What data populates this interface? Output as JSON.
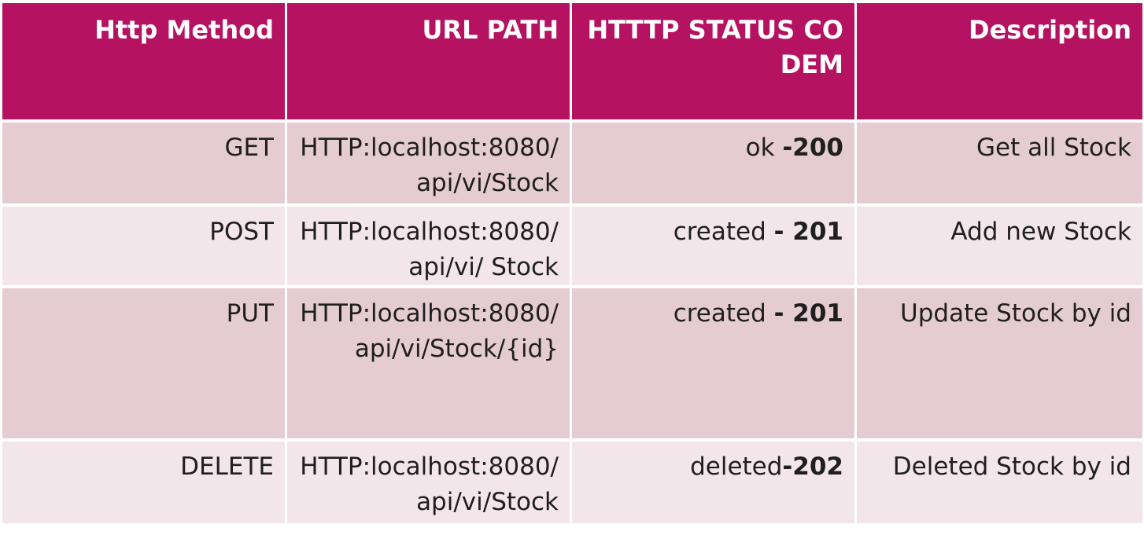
{
  "headers": [
    "Http Method",
    "URL PATH",
    "HTTTP STATUS CODEM",
    "Description"
  ],
  "rows": [
    {
      "method": "GET",
      "url": "HTTP:localhost:8080/api/vi/Stock",
      "status_text": "ok ",
      "status_code": "-200",
      "description": "Get all Stock"
    },
    {
      "method": "POST",
      "url": "HTTP:localhost:8080/api/vi/ Stock",
      "status_text": "created ",
      "status_code": "- 201",
      "description": "Add new Stock"
    },
    {
      "method": "PUT",
      "url": "HTTP:localhost:8080/api/vi/Stock/{id}",
      "status_text": "created ",
      "status_code": "- 201",
      "description": "Update Stock by id"
    },
    {
      "method": "DELETE",
      "url": "HTTP:localhost:8080/api/vi/Stock",
      "status_text": "deleted",
      "status_code": "-202",
      "description": "Deleted Stock by id"
    }
  ],
  "colors": {
    "header_bg": "#b51262",
    "row_odd_bg": "#e5ccd3",
    "row_even_bg": "#f2e6ea",
    "header_text": "#ffffff",
    "body_text": "#1f1f1f"
  }
}
